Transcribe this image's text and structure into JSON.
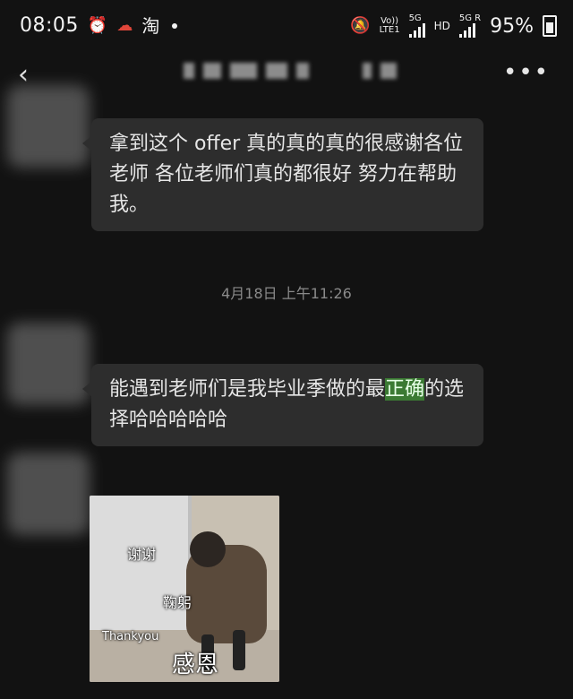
{
  "status_bar": {
    "time": "08:05",
    "icons": [
      "alarm-icon",
      "weather-icon",
      "taobao-icon"
    ],
    "taobao_char": "淘",
    "volte": "Vo))",
    "lte": "LTE1",
    "net1": "5G",
    "hd": "HD",
    "net2": "5G",
    "roaming": "R",
    "battery": "95%"
  },
  "header": {
    "back_icon": "back-chevron-icon",
    "more_icon": "more-dots-icon"
  },
  "messages": [
    {
      "sender": "contact",
      "text": "拿到这个 offer 真的真的真的很感谢各位老师 各位老师们真的都很好 努力在帮助我。"
    },
    {
      "sender": "contact",
      "text_before": "能遇到老师们是我毕业季做的最",
      "highlight": "正确",
      "text_after": "的选择哈哈哈哈哈"
    }
  ],
  "timestamp": "4月18日 上午11:26",
  "sticker": {
    "lines": [
      "谢谢",
      "鞠躬",
      "Thankyou",
      "感恩"
    ]
  }
}
